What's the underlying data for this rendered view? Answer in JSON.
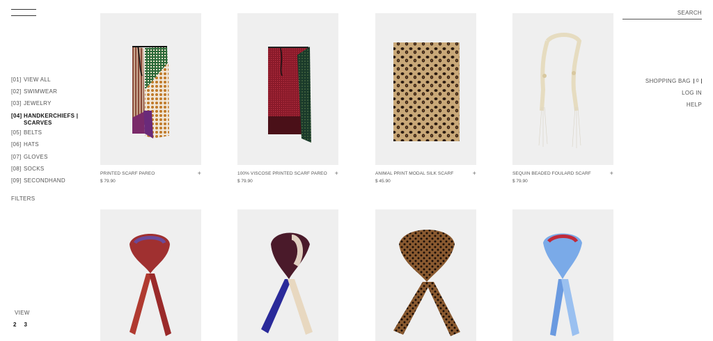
{
  "categories": [
    {
      "index": "[01]",
      "label": "VIEW ALL"
    },
    {
      "index": "[02]",
      "label": "SWIMWEAR"
    },
    {
      "index": "[03]",
      "label": "JEWELRY"
    },
    {
      "index": "[04]",
      "label": "HANDKERCHIEFS | SCARVES"
    },
    {
      "index": "[05]",
      "label": "BELTS"
    },
    {
      "index": "[06]",
      "label": "HATS"
    },
    {
      "index": "[07]",
      "label": "GLOVES"
    },
    {
      "index": "[08]",
      "label": "SOCKS"
    },
    {
      "index": "[09]",
      "label": "SECONDHAND"
    }
  ],
  "active_category": "[04]",
  "filters_label": "FILTERS",
  "view": {
    "label": "VIEW",
    "options": [
      "2",
      "3"
    ]
  },
  "search": {
    "label": "SEARCH"
  },
  "account_nav": {
    "shopping_bag": "SHOPPING BAG",
    "bag_count": "0",
    "login": "LOG IN",
    "help": "HELP"
  },
  "products": [
    {
      "name": "PRINTED SCARF PAREO",
      "price": "$ 79.90"
    },
    {
      "name": "100% VISCOSE PRINTED SCARF PAREO",
      "price": "$ 79.90"
    },
    {
      "name": "ANIMAL PRINT MODAL SILK SCARF",
      "price": "$ 45.90"
    },
    {
      "name": "SEQUIN BEADED FOULARD SCARF",
      "price": "$ 79.90"
    }
  ],
  "add_symbol": "+",
  "colors": {
    "background": "#ffffff",
    "image_bg": "#efefef",
    "text": "#555555"
  }
}
